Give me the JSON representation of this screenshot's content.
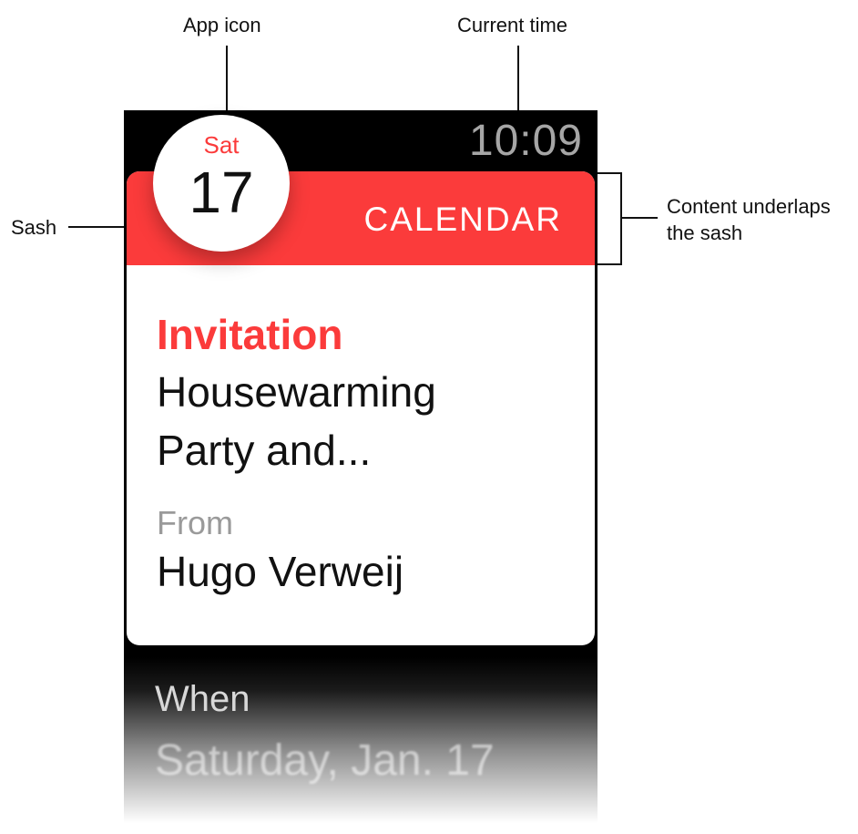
{
  "annotations": {
    "app_icon": "App icon",
    "current_time": "Current time",
    "sash": "Sash",
    "content_underlaps_line1": "Content underlaps",
    "content_underlaps_line2": "the sash"
  },
  "watch": {
    "time": "10:09",
    "app_icon": {
      "day": "Sat",
      "date": "17"
    },
    "sash_label": "CALENDAR",
    "notification": {
      "type": "Invitation",
      "title_line1": "Housewarming",
      "title_line2": "Party and...",
      "from_label": "From",
      "from_name": "Hugo Verweij",
      "when_label": "When",
      "when_value": "Saturday, Jan. 17"
    }
  },
  "colors": {
    "accent_red": "#fb3b3b",
    "time_gray": "#a6a6a6",
    "secondary_text": "#9a9a9a",
    "background": "#000000"
  }
}
